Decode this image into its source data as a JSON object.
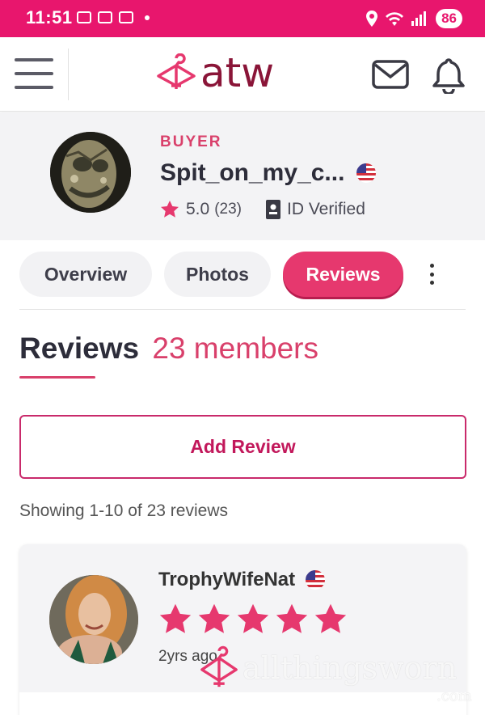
{
  "status_bar": {
    "time": "11:51",
    "battery": "86",
    "icons": [
      "screenshot-icon",
      "card-icon",
      "card-icon",
      "dot-icon",
      "location-icon",
      "wifi-icon",
      "signal-icon"
    ]
  },
  "header": {
    "logo_text": "atw",
    "icons": [
      "menu-icon",
      "mail-icon",
      "bell-icon"
    ]
  },
  "profile": {
    "role": "BUYER",
    "username": "Spit_on_my_c...",
    "rating": "5.0",
    "rating_count": "(23)",
    "verified_label": "ID Verified",
    "flag": "us-flag-icon"
  },
  "tabs": [
    {
      "label": "Overview",
      "active": false
    },
    {
      "label": "Photos",
      "active": false
    },
    {
      "label": "Reviews",
      "active": true
    }
  ],
  "reviews": {
    "title": "Reviews",
    "members_label": "23 members",
    "add_review_label": "Add Review",
    "showing_text": "Showing 1-10 of 23 reviews",
    "items": [
      {
        "reviewer": "TrophyWifeNat",
        "stars": 5,
        "time_ago": "2yrs ago",
        "flag": "us-flag-icon"
      }
    ]
  },
  "watermark": {
    "text": "allthingsworn",
    "sub": ".com"
  },
  "colors": {
    "status_bar": "#e8166d",
    "accent": "#e6386e",
    "brand": "#8a1538",
    "profile_bg": "#f3f3f5"
  }
}
